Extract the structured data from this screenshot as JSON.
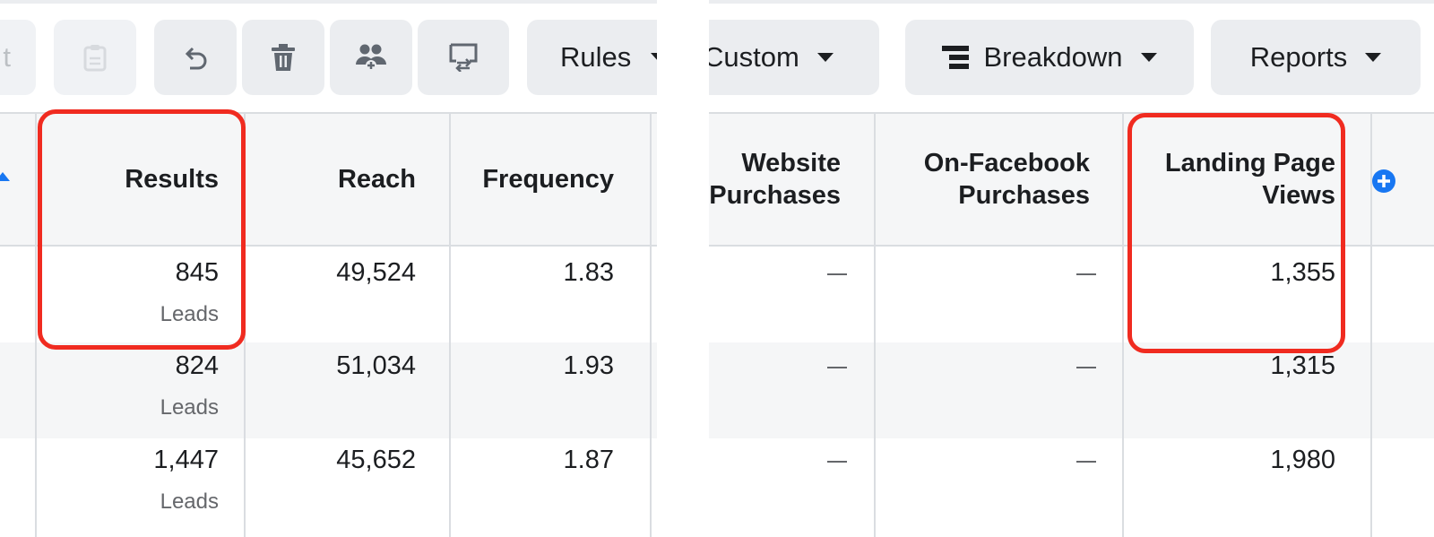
{
  "left_panel": {
    "toolbar": {
      "partial_label": "t",
      "rules_label": "Rules"
    },
    "columns": {
      "results": "Results",
      "reach": "Reach",
      "frequency": "Frequency"
    },
    "rows": [
      {
        "results": "845",
        "results_unit": "Leads",
        "reach": "49,524",
        "frequency": "1.83"
      },
      {
        "results": "824",
        "results_unit": "Leads",
        "reach": "51,034",
        "frequency": "1.93"
      },
      {
        "results": "1,447",
        "results_unit": "Leads",
        "reach": "45,652",
        "frequency": "1.87"
      }
    ]
  },
  "right_panel": {
    "toolbar": {
      "custom_label": "Custom",
      "breakdown_label": "Breakdown",
      "reports_label": "Reports"
    },
    "columns": {
      "website_purchases_line1": "Website",
      "website_purchases_line2": "Purchases",
      "on_facebook_purchases_line1": "On-Facebook",
      "on_facebook_purchases_line2": "Purchases",
      "landing_page_views_line1": "Landing Page",
      "landing_page_views_line2": "Views"
    },
    "rows": [
      {
        "website_purchases": "—",
        "on_facebook_purchases": "—",
        "landing_page_views": "1,355"
      },
      {
        "website_purchases": "—",
        "on_facebook_purchases": "—",
        "landing_page_views": "1,315"
      },
      {
        "website_purchases": "—",
        "on_facebook_purchases": "—",
        "landing_page_views": "1,980"
      }
    ]
  },
  "highlight_color": "#f02b20",
  "accent_color": "#1877f2",
  "icons": [
    "paste-icon",
    "undo-icon",
    "trash-icon",
    "people-add-icon",
    "swap-icon",
    "sort-up-icon",
    "breakdown-icon",
    "add-column-icon"
  ]
}
